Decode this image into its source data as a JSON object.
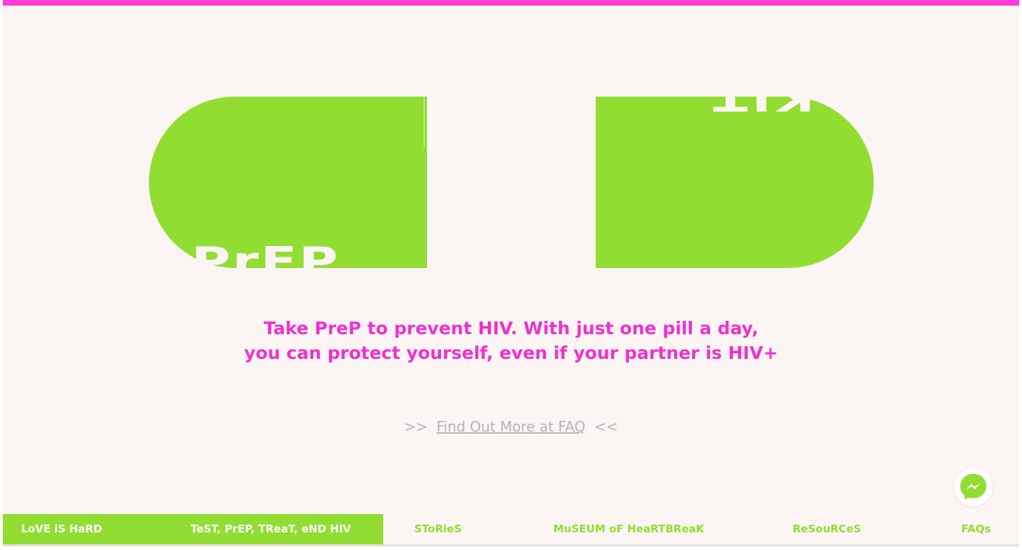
{
  "colors": {
    "accent_pink": "#ff3ad5",
    "text_pink": "#f130cf",
    "pill_green": "#92dd32",
    "background": "#fbf6f4",
    "muted_gray": "#b5b3b3"
  },
  "hero": {
    "pill_left_label": "PrEP",
    "pill_right_label": "KIT",
    "tagline_line1": "Take PreP to prevent HIV. With just one pill a day,",
    "tagline_line2": "you can protect yourself, even if your partner is HIV+"
  },
  "faq": {
    "prefix": ">>",
    "link_text": "Find Out More at FAQ",
    "suffix": "<<"
  },
  "messenger": {
    "icon": "messenger-icon"
  },
  "nav": {
    "items": [
      {
        "label": "LoVE iS HaRD"
      },
      {
        "label": "TeST, PrEP, TReaT, eND HIV"
      },
      {
        "label": "SToRieS"
      },
      {
        "label": "MuSEUM oF HeaRTBReaK"
      },
      {
        "label": "ReSouRCeS"
      },
      {
        "label": "FAQs"
      }
    ]
  }
}
